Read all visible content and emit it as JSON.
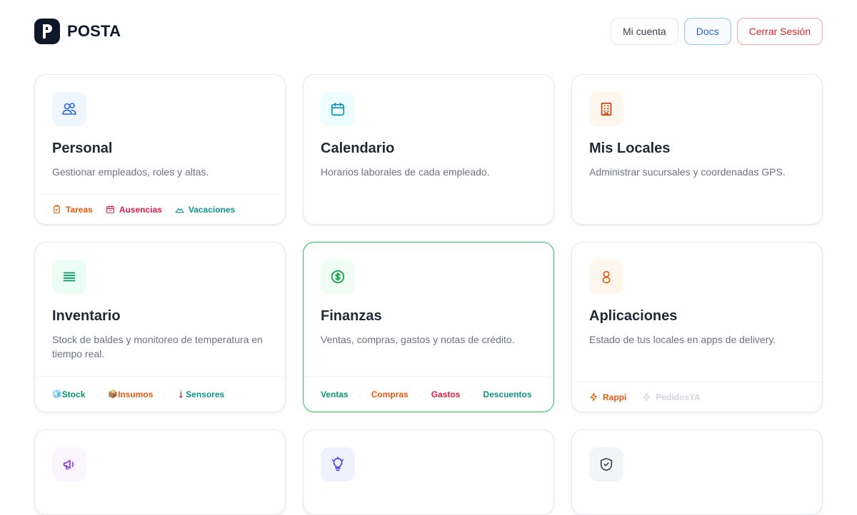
{
  "brand": {
    "name": "POSTA",
    "logo_letter": "P"
  },
  "nav": {
    "account": "Mi cuenta",
    "docs": "Docs",
    "logout": "Cerrar Sesión"
  },
  "cards": [
    {
      "title": "Personal",
      "desc": "Gestionar empleados, roles y altas.",
      "icon": "users-icon",
      "links": [
        {
          "label": "Tareas",
          "icon": "clipboard-icon",
          "color": "#ea580c"
        },
        {
          "label": "Ausencias",
          "icon": "calendar-icon",
          "color": "#e11d48"
        },
        {
          "label": "Vacaciones",
          "icon": "mountain-icon",
          "color": "#0d9488"
        }
      ]
    },
    {
      "title": "Calendario",
      "desc": "Horarios laborales de cada empleado.",
      "icon": "calendar-icon"
    },
    {
      "title": "Mis Locales",
      "desc": "Administrar sucursales y coordenadas GPS.",
      "icon": "building-icon"
    },
    {
      "title": "Inventario",
      "desc": "Stock de baldes y monitoreo de temperatura en tiempo real.",
      "icon": "list-icon",
      "links": [
        {
          "label": "Stock",
          "emoji": "🧊",
          "color": "#059669"
        },
        {
          "label": "Insumos",
          "emoji": "📦",
          "color": "#ea580c"
        },
        {
          "label": "Sensores",
          "emoji": "🌡️",
          "color": "#0d9488"
        }
      ]
    },
    {
      "title": "Finanzas",
      "desc": "Ventas, compras, gastos y notas de crédito.",
      "icon": "dollar-icon",
      "links": [
        {
          "label": "Ventas",
          "color": "#059669"
        },
        {
          "label": "Compras",
          "color": "#ea580c"
        },
        {
          "label": "Gastos",
          "color": "#e11d48"
        },
        {
          "label": "Descuentos",
          "color": "#0d9488"
        }
      ]
    },
    {
      "title": "Aplicaciones",
      "desc": "Estado de tus locales en apps de delivery.",
      "icon": "app-icon",
      "links": [
        {
          "label": "Rappi",
          "icon": "bolt-icon",
          "color": "#ea580c"
        },
        {
          "label": "PedidosYA",
          "icon": "bolt-icon",
          "color": "#d1d5db"
        }
      ]
    }
  ],
  "colors": {
    "accent_blue": "#2563eb",
    "accent_green": "#22c55e",
    "danger": "#dc2626"
  }
}
